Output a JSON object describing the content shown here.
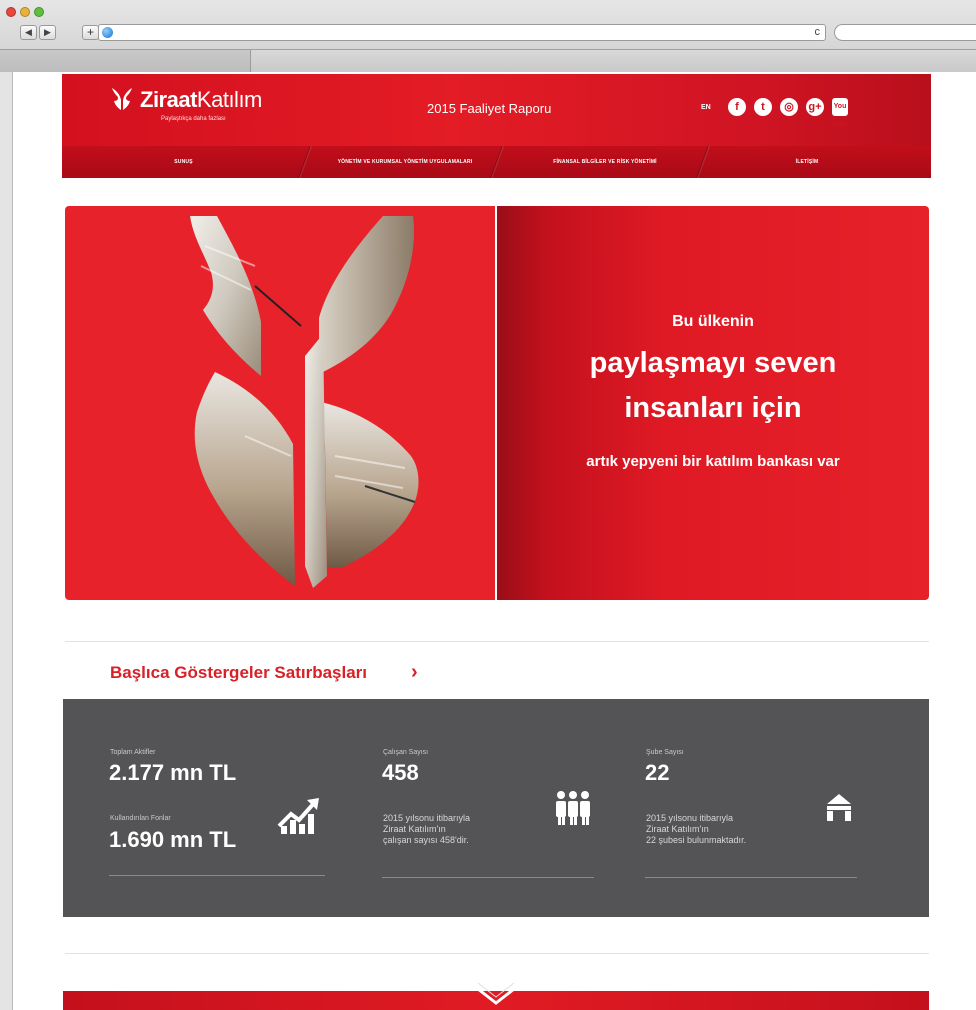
{
  "browser": {
    "back_label": "◀",
    "forward_label": "▶",
    "add_label": "+",
    "reload_label": "c"
  },
  "header": {
    "logo_brand": "Ziraat",
    "logo_name": "Katılım",
    "logo_tagline": "Paylaştıkça daha fazlası",
    "report_title": "2015 Faaliyet Raporu",
    "lang_label": "EN",
    "social": {
      "facebook": "f",
      "twitter": "t",
      "instagram": "◎",
      "googleplus": "g+",
      "youtube": "You Tube"
    },
    "nav": [
      {
        "label": "SUNUŞ"
      },
      {
        "label": "YÖNETİM VE KURUMSAL YÖNETİM UYGULAMALARI"
      },
      {
        "label": "FİNANSAL BİLGİLER VE RİSK YÖNETİMİ"
      },
      {
        "label": "İLETİŞİM"
      }
    ]
  },
  "hero": {
    "line1": "Bu ülkenin",
    "line2": "paylaşmayı seven",
    "line3": "insanları için",
    "line4": "artık yepyeni bir katılım bankası var"
  },
  "section": {
    "title": "Başlıca Göstergeler Satırbaşları",
    "arrow": "›"
  },
  "stats": {
    "assets_label": "Toplam Aktifler",
    "assets_value": "2.177 mn TL",
    "funds_label": "Kullandırılan Fonlar",
    "funds_value": "1.690 mn TL",
    "employees_label": "Çalışan Sayısı",
    "employees_value": "458",
    "employees_desc": [
      "2015 yılsonu itibarıyla",
      "Ziraat Katılım'ın",
      "çalışan sayısı 458'dir."
    ],
    "branches_label": "Şube Sayısı",
    "branches_value": "22",
    "branches_desc": [
      "2015 yılsonu itibarıyla",
      "Ziraat Katılım'ın",
      "22 şubesi bulunmaktadır."
    ]
  },
  "colors": {
    "brand_red": "#e31c25",
    "panel_gray": "#545456"
  }
}
